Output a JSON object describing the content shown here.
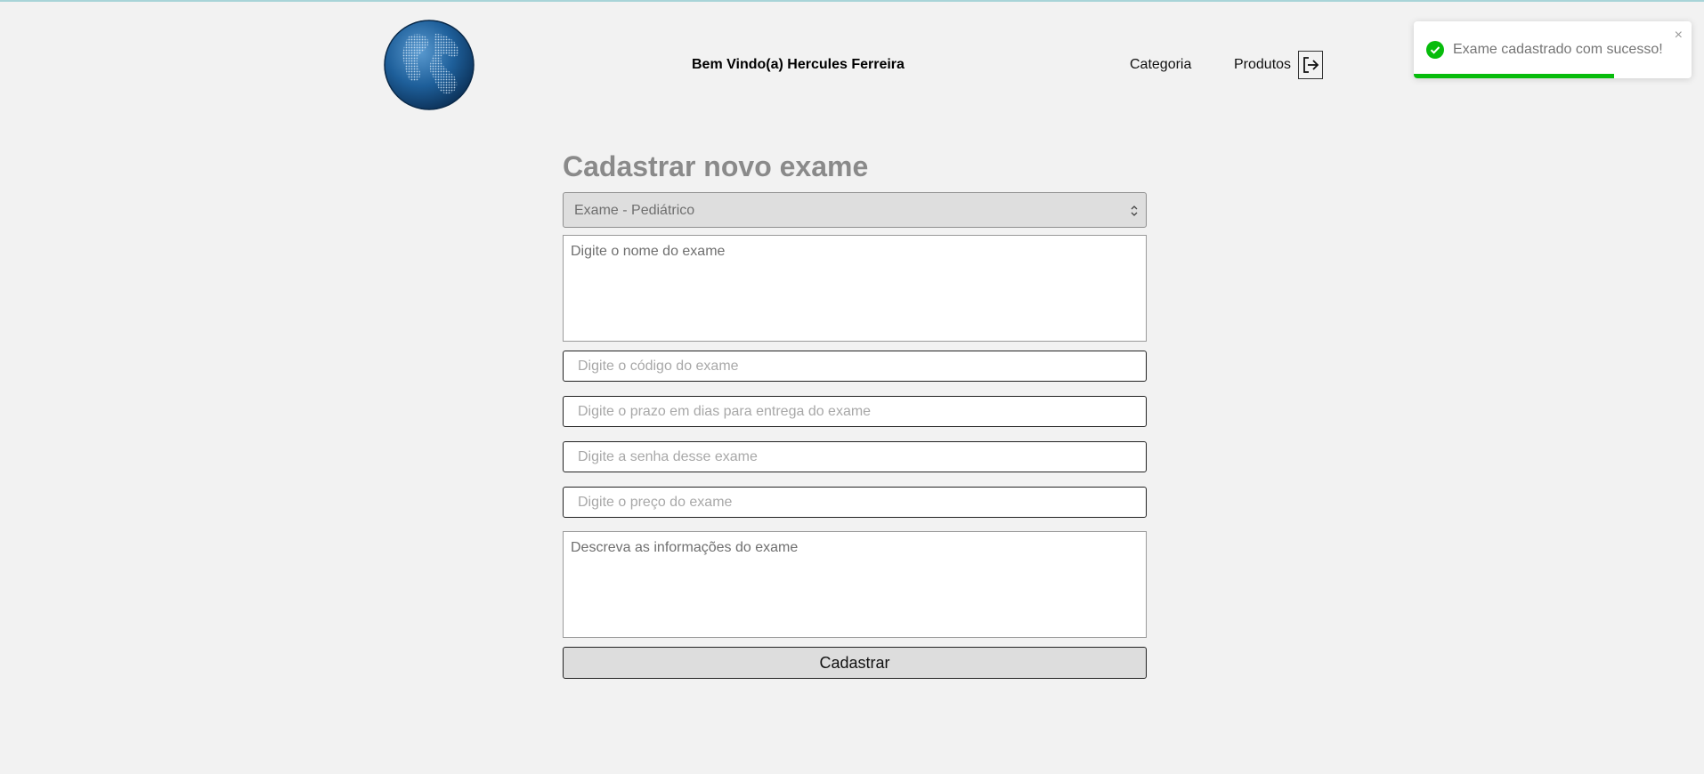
{
  "header": {
    "welcome": "Bem Vindo(a) Hercules Ferreira",
    "nav": {
      "categoria": "Categoria",
      "produtos": "Produtos"
    },
    "logo_icon": "globe-icon",
    "logout_icon": "logout-icon"
  },
  "form": {
    "title": "Cadastrar novo exame",
    "category_select": {
      "selected": "Exame - Pediátrico"
    },
    "name_placeholder": "Digite o nome do exame",
    "code_placeholder": "Digite o código do exame",
    "deadline_placeholder": "Digite o prazo em dias para entrega do exame",
    "password_placeholder": "Digite a senha desse exame",
    "price_placeholder": "Digite o preço do exame",
    "description_placeholder": "Descreva as informações do exame",
    "submit_label": "Cadastrar"
  },
  "toast": {
    "message": "Exame cadastrado com sucesso!",
    "close_glyph": "×",
    "progress": 0.72,
    "status": "success",
    "accent": "#07bc0c"
  },
  "colors": {
    "background": "#f2f2f2",
    "title": "#8a8a8a",
    "success": "#07bc0c"
  }
}
